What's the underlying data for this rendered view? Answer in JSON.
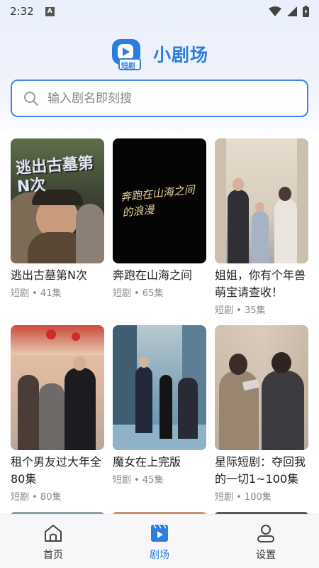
{
  "status_bar": {
    "time": "2:32",
    "notification_letter": "A"
  },
  "header": {
    "title": "小剧场",
    "logo_text": "短剧"
  },
  "search": {
    "placeholder": "输入剧名即刻搜"
  },
  "colors": {
    "accent": "#2a7de1",
    "muted": "#8a8a8a"
  },
  "dramas": [
    {
      "title": "逃出古墓第N次",
      "poster_text": "逃出古墓第N次",
      "meta": "短剧 • 41集"
    },
    {
      "title": "奔跑在山海之间",
      "poster_text": "奔跑在山海之间的浪漫",
      "meta": "短剧 • 65集"
    },
    {
      "title": "姐姐，你有个年兽萌宝请查收！",
      "meta": "短剧 • 35集"
    },
    {
      "title": "租个男友过大年全80集",
      "meta": "短剧 • 80集"
    },
    {
      "title": "魔女在上完版",
      "meta": "短剧 • 45集"
    },
    {
      "title": "星际短剧：夺回我的一切1~100集",
      "meta": "短剧 • 100集"
    }
  ],
  "nav": [
    {
      "label": "首页",
      "icon": "home-icon",
      "active": false
    },
    {
      "label": "剧场",
      "icon": "theater-icon",
      "active": true
    },
    {
      "label": "设置",
      "icon": "user-icon",
      "active": false
    }
  ]
}
